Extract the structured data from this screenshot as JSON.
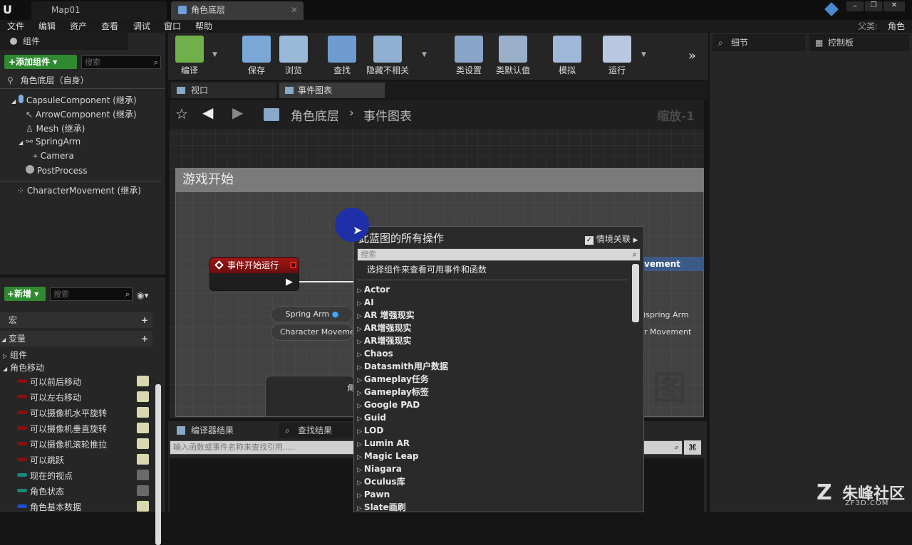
{
  "titlebar": {
    "tabs": [
      {
        "label": "Map01"
      },
      {
        "label": "角色底层"
      }
    ],
    "parent_label": "父类:",
    "parent_value": "角色"
  },
  "menu": [
    "文件",
    "编辑",
    "资产",
    "查看",
    "调试",
    "窗口",
    "帮助"
  ],
  "components_panel": {
    "title": "组件",
    "add_button": "+添加组件",
    "search_placeholder": "搜索",
    "root": "角色底层（自身）",
    "items": [
      "CapsuleComponent (继承)",
      "ArrowComponent (继承)",
      "Mesh (继承)",
      "SpringArm",
      "Camera",
      "PostProcess",
      "CharacterMovement (继承)"
    ]
  },
  "my_blueprint": {
    "new_button": "+新增",
    "search_placeholder": "搜索",
    "sections": {
      "macro": "宏",
      "variables": "变量",
      "components": "组件",
      "category": "角色移动"
    },
    "variables": [
      {
        "name": "可以前后移动",
        "color": "#8b0f0f",
        "visible": true
      },
      {
        "name": "可以左右移动",
        "color": "#8b0f0f",
        "visible": true
      },
      {
        "name": "可以摄像机水平旋转",
        "color": "#8b0f0f",
        "visible": true
      },
      {
        "name": "可以摄像机垂直旋转",
        "color": "#8b0f0f",
        "visible": true
      },
      {
        "name": "可以摄像机滚轮推拉",
        "color": "#8b0f0f",
        "visible": true
      },
      {
        "name": "可以跳跃",
        "color": "#8b0f0f",
        "visible": true
      },
      {
        "name": "现在的视点",
        "color": "#1a8a7a",
        "visible": false
      },
      {
        "name": "角色状态",
        "color": "#1a8a7a",
        "visible": false
      },
      {
        "name": "角色基本数据",
        "color": "#1f4fc9",
        "visible": true
      }
    ]
  },
  "toolbar": {
    "buttons": [
      {
        "label": "编译",
        "color": "#6fb04a"
      },
      {
        "label": "保存",
        "color": "#7aa7d6"
      },
      {
        "label": "浏览",
        "color": "#9ab8d8"
      },
      {
        "label": "查找",
        "color": "#6e9bd0"
      },
      {
        "label": "隐藏不相关",
        "color": "#8fb0d0"
      },
      {
        "label": "类设置",
        "color": "#8aa4c8"
      },
      {
        "label": "类默认值",
        "color": "#9ab0c8"
      },
      {
        "label": "模拟",
        "color": "#9fb7d8"
      },
      {
        "label": "运行",
        "color": "#b8c8e0"
      }
    ]
  },
  "editor_tabs": {
    "viewport": "视口",
    "event_graph": "事件图表"
  },
  "graph": {
    "breadcrumb_root": "角色底层",
    "breadcrumb_leaf": "事件图表",
    "zoom": "缩放-1",
    "comment_title": "游戏开始",
    "event_node": "事件开始运行",
    "var_node_1": "Spring Arm",
    "var_node_2": "Character Movemen",
    "partial_right_1": "vement",
    "partial_right_2": ")spring Arm",
    "partial_right_3": "r Movement",
    "watermark": "图",
    "partial_node": "角"
  },
  "bottom": {
    "compiler_tab": "编译器结果",
    "find_tab": "查找结果",
    "find_placeholder": "输入函数或事件名称来查找引用....."
  },
  "right": {
    "details": "细节",
    "control": "控制板"
  },
  "context_menu": {
    "title": "此蓝图的所有操作",
    "context_label": "情境关联",
    "search_placeholder": "搜索",
    "hint": "选择组件来查看可用事件和函数",
    "items": [
      "Actor",
      "AI",
      "AR 增强现实",
      "AR增强现实",
      "AR增强现实",
      "Chaos",
      "Datasmith用户数据",
      "Gameplay任务",
      "Gameplay标签",
      "Google PAD",
      "Guid",
      "LOD",
      "Lumin AR",
      "Magic Leap",
      "Niagara",
      "Oculus库",
      "Pawn",
      "Slate画刷"
    ]
  },
  "watermark_site": {
    "name": "朱峰社区",
    "url": "ZF3D.COM"
  }
}
